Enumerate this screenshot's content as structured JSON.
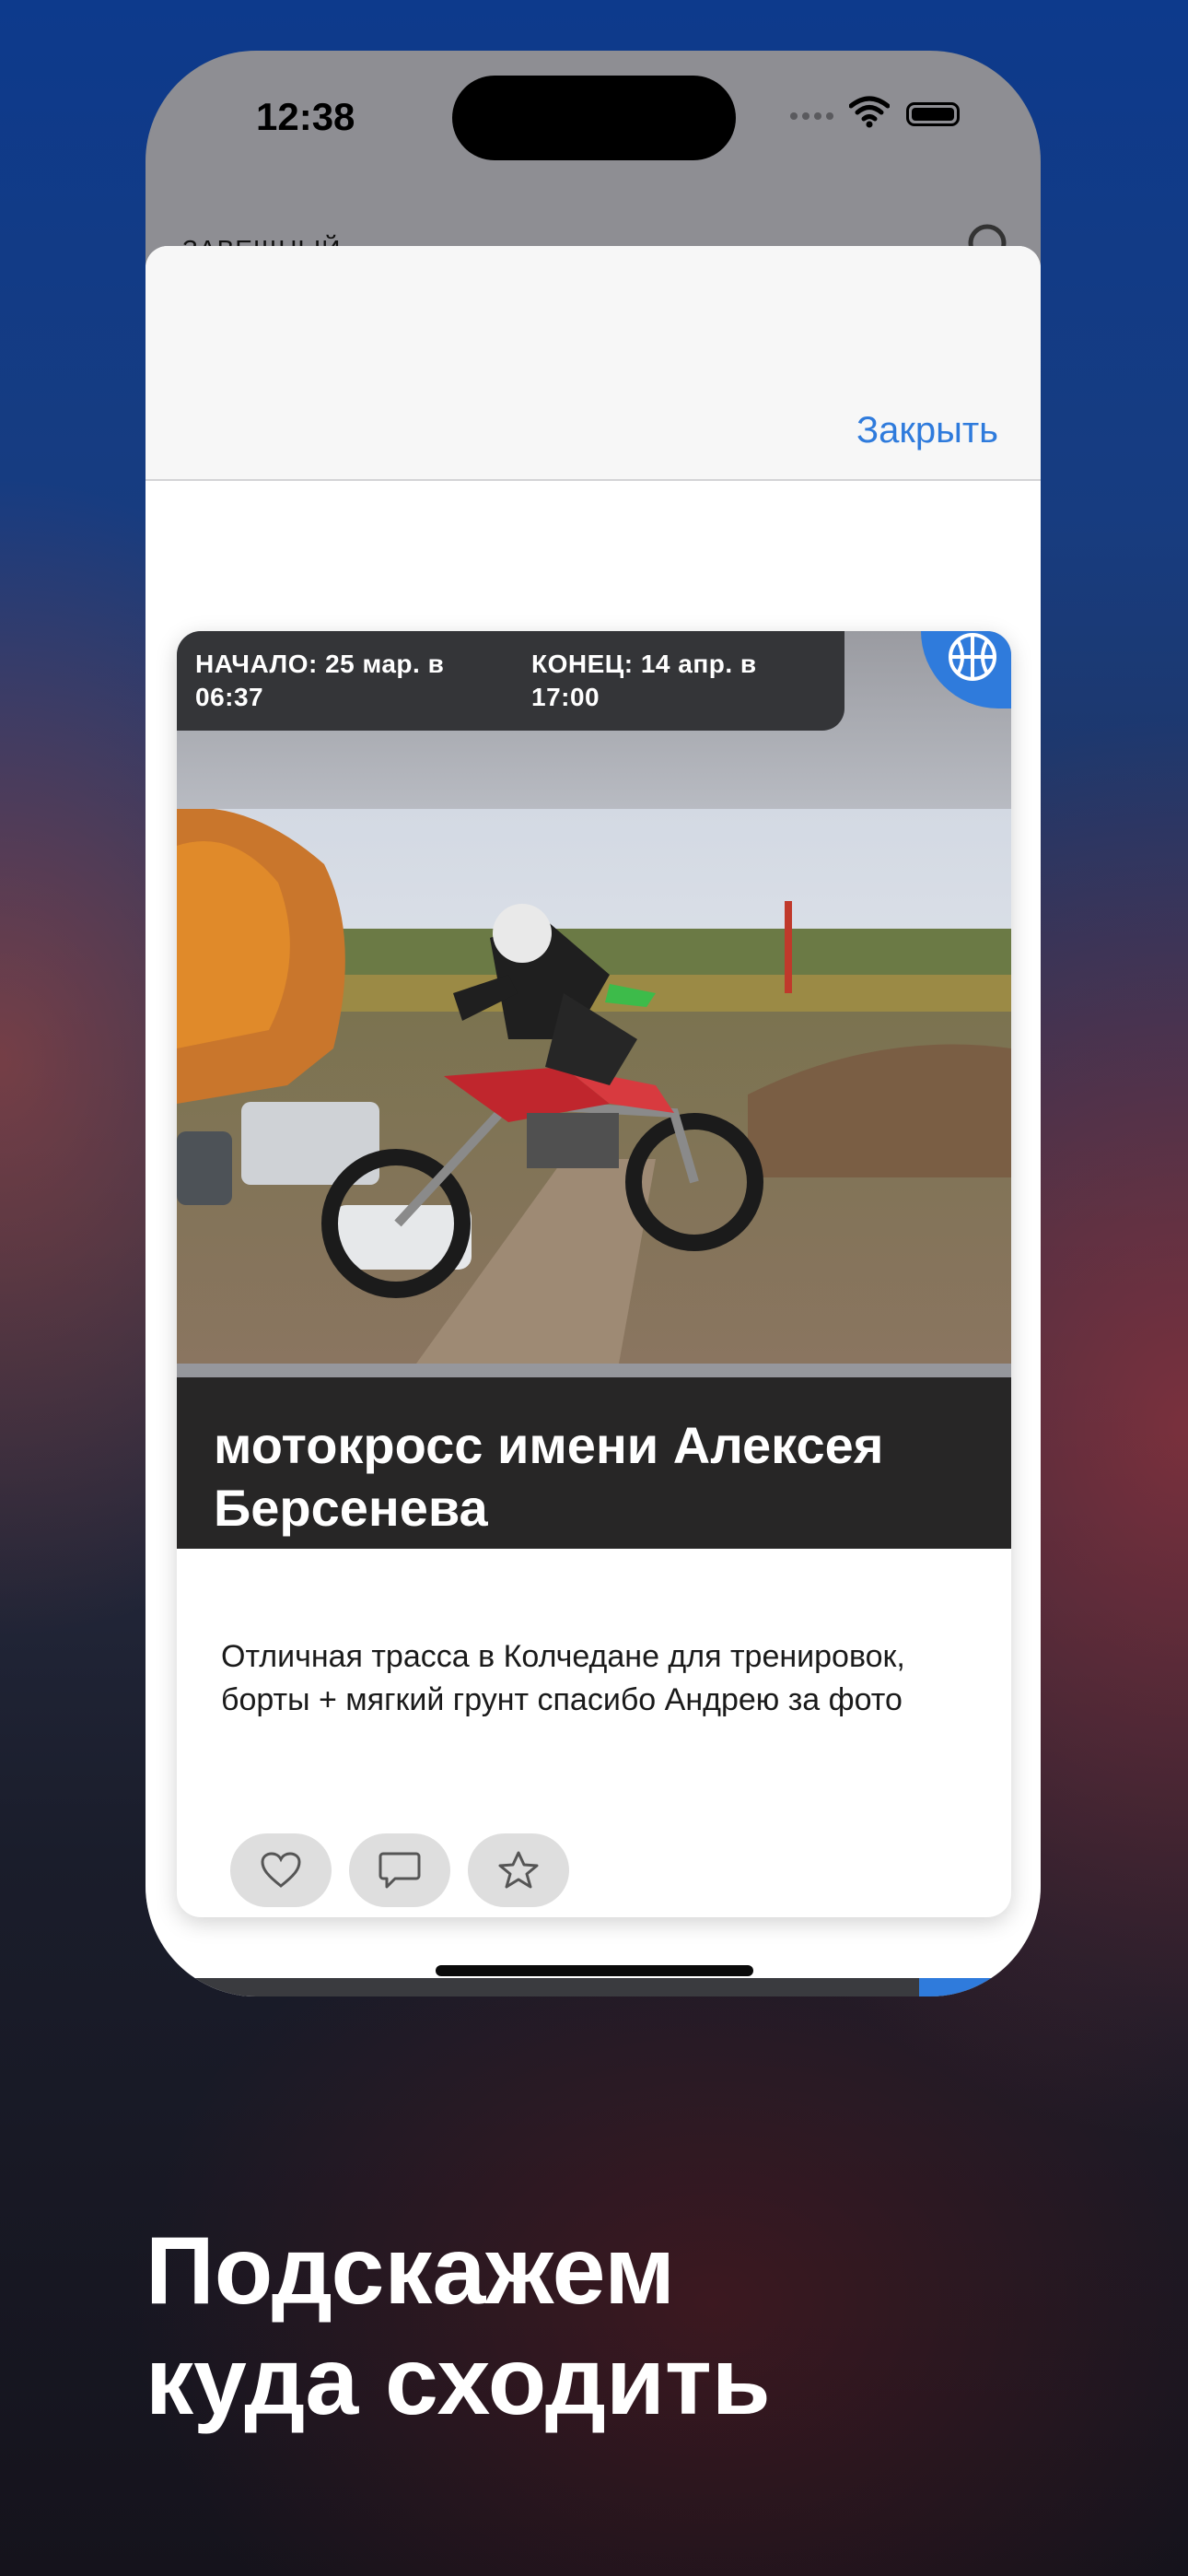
{
  "status_bar": {
    "time": "12:38"
  },
  "background_screen": {
    "header_text": "ЗАВЕЩНЫЙ"
  },
  "sheet": {
    "close_label": "Закрыть"
  },
  "event_card": {
    "start_label": "НАЧАЛО: 25 мар. в 06:37",
    "end_label": "КОНЕЦ: 14 апр. в 17:00",
    "category_icon": "basketball-icon",
    "title": "мотокросс имени Алексея Берсенева",
    "description": "Отличная трасса в Колчедане для тренировок, борты + мягкий грунт спасибо Андрею за фото",
    "actions": [
      "heart-icon",
      "comment-icon",
      "star-icon"
    ]
  },
  "promo": {
    "line1": "Подскажем",
    "line2": "куда сходить"
  },
  "colors": {
    "accent": "#2f7bdc",
    "title_band": "#272626"
  }
}
